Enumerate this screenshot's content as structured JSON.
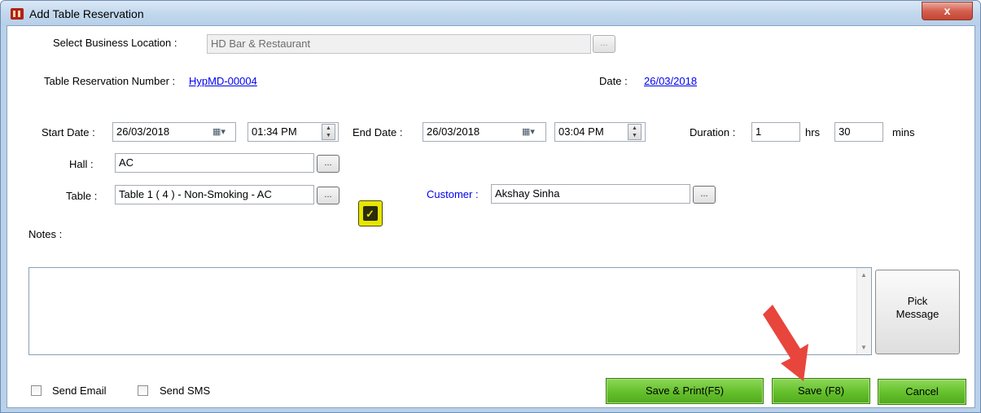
{
  "window": {
    "title": "Add Table Reservation",
    "close_glyph": "x"
  },
  "form": {
    "business_location": {
      "label": "Select Business Location :",
      "value": "HD Bar & Restaurant",
      "browse": "..."
    },
    "reservation_number": {
      "label": "Table Reservation Number :",
      "value": "HypMD-00004"
    },
    "date": {
      "label": "Date :",
      "value": "26/03/2018"
    },
    "start_date": {
      "label": "Start Date :",
      "date": "26/03/2018",
      "time": "01:34 PM"
    },
    "end_date": {
      "label": "End Date :",
      "date": "26/03/2018",
      "time": "03:04 PM"
    },
    "duration": {
      "label": "Duration :",
      "hours": "1",
      "hours_unit": "hrs",
      "minutes": "30",
      "minutes_unit": "mins"
    },
    "hall": {
      "label": "Hall :",
      "value": "AC",
      "browse": "..."
    },
    "table": {
      "label": "Table :",
      "value": "Table 1 ( 4 )  - Non-Smoking - AC",
      "browse": "..."
    },
    "customer": {
      "label": "Customer :",
      "value": "Akshay Sinha",
      "browse": "..."
    },
    "notes": {
      "label": "Notes :",
      "value": ""
    },
    "pick_message": "Pick\nMessage"
  },
  "footer": {
    "send_email": "Send Email",
    "send_sms": "Send SMS",
    "save_print": "Save & Print(F5)",
    "save": "Save (F8)",
    "cancel": "Cancel"
  },
  "colors": {
    "accent_button": "#64c02b",
    "link": "#0000ee",
    "annotation_arrow": "#e8453c",
    "calendar_button": "#e6e600"
  }
}
